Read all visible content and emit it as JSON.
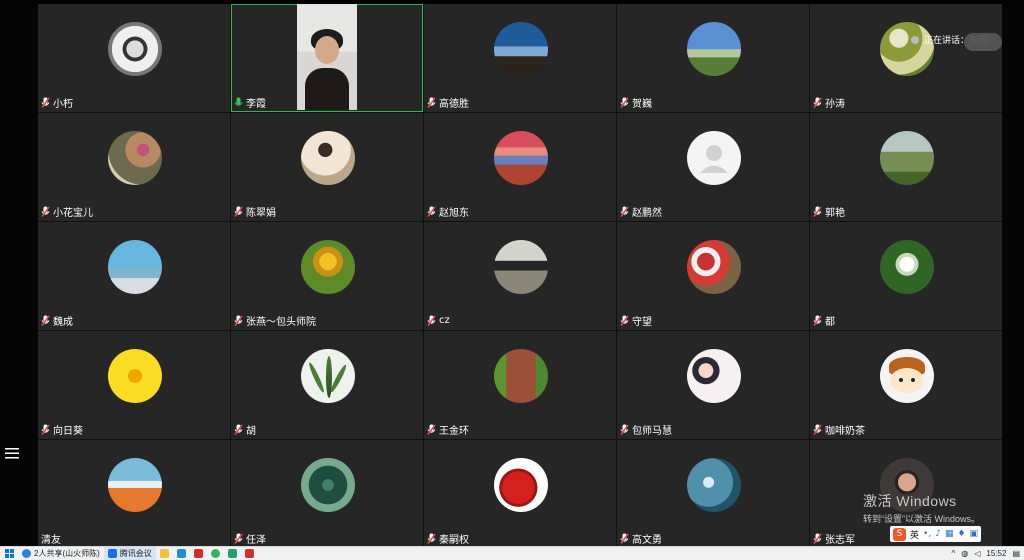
{
  "meeting": {
    "speaking_label": "正在讲话：李霞;",
    "participants": [
      {
        "name": "小朽",
        "avatar": "dog-photo",
        "mic": "muted"
      },
      {
        "name": "李霞",
        "avatar": "video",
        "mic": "active"
      },
      {
        "name": "高德胜",
        "avatar": "horses-sunset",
        "mic": "muted"
      },
      {
        "name": "贺巍",
        "avatar": "grassland-sky",
        "mic": "muted"
      },
      {
        "name": "孙涛",
        "avatar": "lily-pads",
        "mic": "muted"
      },
      {
        "name": "小花宝儿",
        "avatar": "flowers-girl",
        "mic": "muted"
      },
      {
        "name": "陈翠娟",
        "avatar": "woman-hair",
        "mic": "muted"
      },
      {
        "name": "赵旭东",
        "avatar": "desert-sunset",
        "mic": "muted"
      },
      {
        "name": "赵鹏然",
        "avatar": "default-person",
        "mic": "muted"
      },
      {
        "name": "郭艳",
        "avatar": "meadow-person",
        "mic": "muted"
      },
      {
        "name": "魏成",
        "avatar": "beach-people",
        "mic": "muted"
      },
      {
        "name": "张燕～包头师院",
        "avatar": "yellow-flowers",
        "mic": "muted"
      },
      {
        "name": "cz",
        "avatar": "bridge",
        "mic": "muted"
      },
      {
        "name": "守望",
        "avatar": "group-red",
        "mic": "muted"
      },
      {
        "name": "都",
        "avatar": "white-flower",
        "mic": "muted"
      },
      {
        "name": "向日葵",
        "avatar": "sunflower",
        "mic": "muted"
      },
      {
        "name": "胡",
        "avatar": "plant-white",
        "mic": "muted"
      },
      {
        "name": "王金环",
        "avatar": "road-trees",
        "mic": "muted"
      },
      {
        "name": "包师马慧",
        "avatar": "anime-girls",
        "mic": "muted"
      },
      {
        "name": "咖啡奶茶",
        "avatar": "cartoon-face",
        "mic": "muted"
      },
      {
        "name": "清友",
        "avatar": "sky-orange",
        "mic": "muted"
      },
      {
        "name": "任泽",
        "avatar": "lotus-pond",
        "mic": "muted"
      },
      {
        "name": "秦嗣权",
        "avatar": "red-apple",
        "mic": "muted"
      },
      {
        "name": "高文勇",
        "avatar": "water-figure",
        "mic": "muted"
      },
      {
        "name": "张志军",
        "avatar": "man-face",
        "mic": "muted"
      }
    ]
  },
  "watermark": {
    "title": "激活 Windows",
    "subtitle": "转到“设置”以激活 Windows。"
  },
  "taskbar": {
    "items": [
      "2人共享(山火师陈)",
      "腾讯会议",
      "",
      "",
      "",
      "",
      "",
      "",
      ""
    ],
    "time": "15:52",
    "ime_label": "英"
  },
  "colors": {
    "tile": "#262626",
    "active_border": "#2db55d",
    "mic_muted": "#e14c4c",
    "mic_active": "#35c65d"
  }
}
